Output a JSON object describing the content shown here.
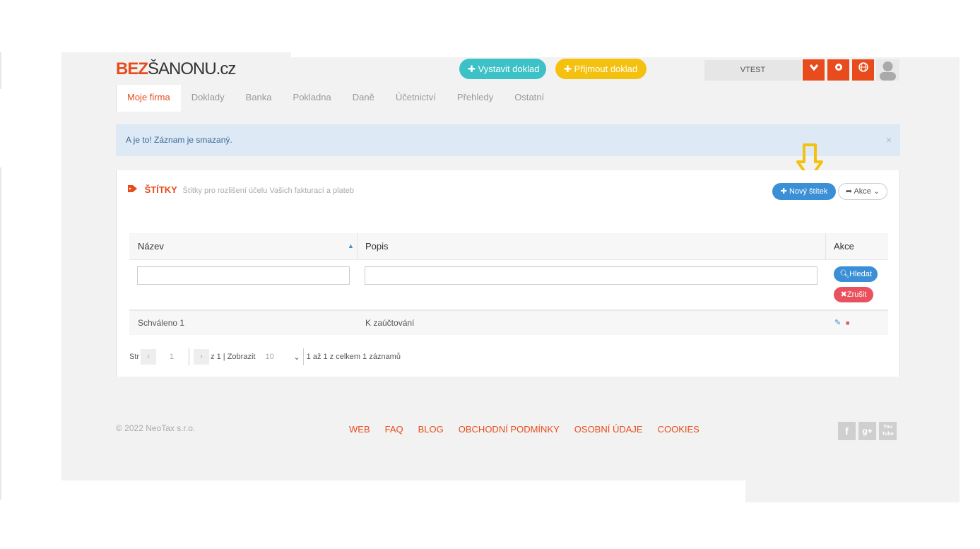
{
  "logo": {
    "brand": "BEZ",
    "rest": "ŠANONU.cz"
  },
  "header": {
    "issue_doc": "Vystavit doklad",
    "receive_doc": "Přijmout doklad",
    "user": "VTEST"
  },
  "nav": {
    "items": [
      "Moje firma",
      "Doklady",
      "Banka",
      "Pokladna",
      "Daně",
      "Účetnictví",
      "Přehledy",
      "Ostatní"
    ]
  },
  "alert": {
    "text": "A je to! Záznam je smazaný.",
    "close": "×"
  },
  "panel": {
    "title": "ŠTÍTKY",
    "subtitle": "Štítky pro rozlišení účelu Vašich fakturací a plateb",
    "new_button": "Nový štítek",
    "actions_button": "Akce"
  },
  "table": {
    "columns": [
      "Název",
      "Popis",
      "Akce"
    ],
    "filter_name_value": "",
    "filter_desc_value": "",
    "search_button": "Hledat",
    "cancel_button": "Zrušit",
    "rows": [
      {
        "name": "Schváleno 1",
        "description": "K zaúčtování"
      }
    ]
  },
  "pager": {
    "page_label": "Str",
    "current_page": "1",
    "of_pages": "z 1 | Zobrazit",
    "page_size": "10",
    "summary": "1 až 1 z celkem 1 záznamů"
  },
  "footer": {
    "copyright": "© 2022 NeoTax s.r.o.",
    "links": [
      "WEB",
      "FAQ",
      "BLOG",
      "OBCHODNÍ PODMÍNKY",
      "OSOBNÍ ÚDAJE",
      "COOKIES"
    ],
    "social": [
      "f",
      "g+",
      "You Tube"
    ]
  },
  "colors": {
    "accent": "#e84c1d",
    "primary": "#3b8fd6",
    "teal": "#3cc1c7",
    "yellow": "#f4c10f",
    "danger": "#e8515d",
    "highlight_arrow": "#f4c10f"
  }
}
